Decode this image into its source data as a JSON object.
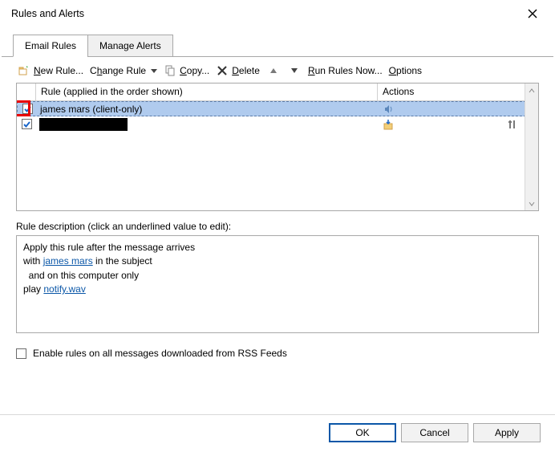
{
  "title": "Rules and Alerts",
  "tabs": {
    "email_rules": "Email Rules",
    "manage_alerts": "Manage Alerts"
  },
  "toolbar": {
    "new_rule": "New Rule...",
    "change_rule": "Change Rule",
    "copy": "Copy...",
    "delete": "Delete",
    "run_now": "Run Rules Now...",
    "options": "Options"
  },
  "list": {
    "header_rule": "Rule (applied in the order shown)",
    "header_actions": "Actions",
    "rows": [
      {
        "checked": true,
        "name": "james mars  (client-only)",
        "selected": true,
        "action_icon": "sound"
      },
      {
        "checked": true,
        "name": "",
        "redacted": true,
        "selected": false,
        "action_icon": "folder"
      }
    ]
  },
  "description": {
    "label": "Rule description (click an underlined value to edit):",
    "line1": "Apply this rule after the message arrives",
    "line2a": "with ",
    "line2_link": "james mars",
    "line2b": " in the subject",
    "line3": "  and on this computer only",
    "line4a": "play ",
    "line4_link": "notify.wav"
  },
  "rss": {
    "label": "Enable rules on all messages downloaded from RSS Feeds",
    "checked": false
  },
  "buttons": {
    "ok": "OK",
    "cancel": "Cancel",
    "apply": "Apply"
  }
}
